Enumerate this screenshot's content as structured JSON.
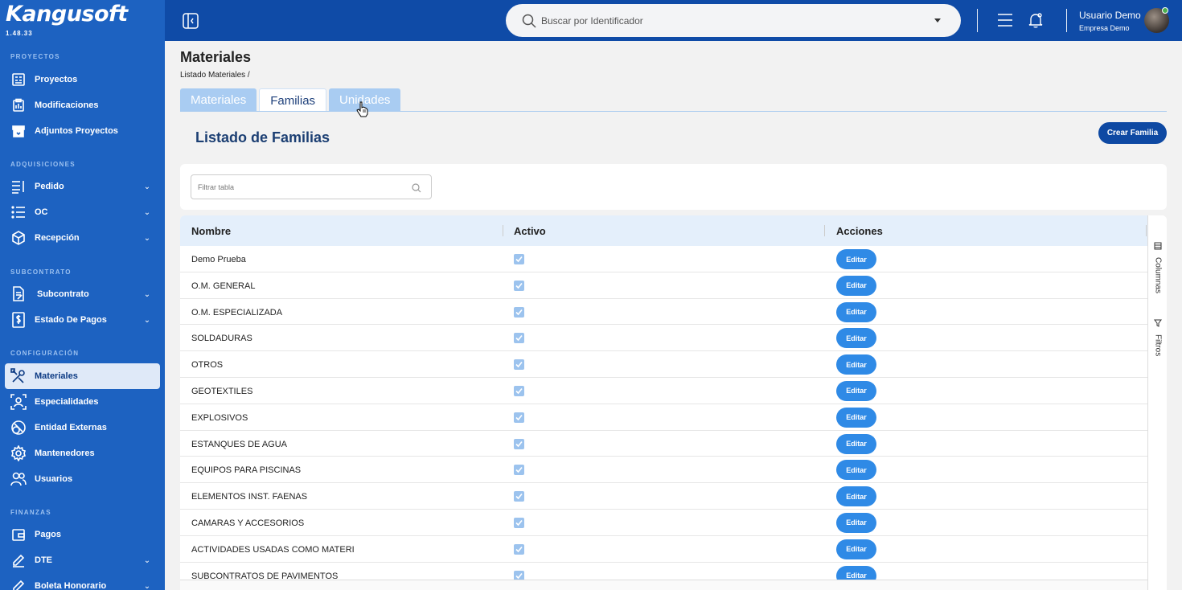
{
  "app": {
    "logo": "Kangusoft",
    "version": "1.48.33"
  },
  "sidebar": {
    "sections": [
      {
        "title": "PROYECTOS"
      },
      {
        "title": "ADQUISICIONES"
      },
      {
        "title": "SUBCONTRATO"
      },
      {
        "title": "CONFIGURACIÓN"
      },
      {
        "title": "FINANZAS"
      }
    ],
    "items": [
      {
        "label": "Proyectos",
        "icon": "projects-icon"
      },
      {
        "label": "Modificaciones",
        "icon": "modifications-icon"
      },
      {
        "label": "Adjuntos Proyectos",
        "icon": "archive-icon"
      },
      {
        "label": "Pedido",
        "icon": "list-icon"
      },
      {
        "label": "OC",
        "icon": "list-bullets-icon"
      },
      {
        "label": "Recepción",
        "icon": "box-icon"
      },
      {
        "label": "Subcontrato",
        "icon": "document-edit-icon"
      },
      {
        "label": "Estado De Pagos",
        "icon": "dollar-icon"
      },
      {
        "label": "Materiales",
        "icon": "tools-icon"
      },
      {
        "label": "Especialidades",
        "icon": "user-frame-icon"
      },
      {
        "label": "Entidad Externas",
        "icon": "circles-icon"
      },
      {
        "label": "Mantenedores",
        "icon": "gear-icon"
      },
      {
        "label": "Usuarios",
        "icon": "users-icon"
      },
      {
        "label": "Pagos",
        "icon": "wallet-icon"
      },
      {
        "label": "DTE",
        "icon": "pencil-icon"
      },
      {
        "label": "Boleta Honorario",
        "icon": "pencil-icon"
      }
    ]
  },
  "topbar": {
    "search_placeholder": "Buscar por Identificador",
    "user_name": "Usuario Demo",
    "company": "Empresa Demo"
  },
  "main": {
    "title": "Materiales",
    "breadcrumb": "Listado Materiales /",
    "tabs": [
      {
        "label": "Materiales"
      },
      {
        "label": "Familias"
      },
      {
        "label": "Unidades"
      }
    ],
    "section_heading": "Listado de Familias",
    "create_button": "Crear Familia",
    "filter_placeholder": "Filtrar tabla",
    "columns": [
      "Nombre",
      "Activo",
      "Acciones"
    ],
    "side_panel": {
      "columns": "Columnas",
      "filters": "Filtros"
    },
    "edit_label": "Editar",
    "rows": [
      {
        "name": "Demo Prueba",
        "active": true
      },
      {
        "name": "O.M. GENERAL",
        "active": true
      },
      {
        "name": "O.M. ESPECIALIZADA",
        "active": true
      },
      {
        "name": "SOLDADURAS",
        "active": true
      },
      {
        "name": "OTROS",
        "active": true
      },
      {
        "name": "GEOTEXTILES",
        "active": true
      },
      {
        "name": "EXPLOSIVOS",
        "active": true
      },
      {
        "name": "ESTANQUES DE AGUA",
        "active": true
      },
      {
        "name": "EQUIPOS PARA PISCINAS",
        "active": true
      },
      {
        "name": "ELEMENTOS INST. FAENAS",
        "active": true
      },
      {
        "name": "CAMARAS Y ACCESORIOS",
        "active": true
      },
      {
        "name": "ACTIVIDADES USADAS COMO MATERI",
        "active": true
      },
      {
        "name": "SUBCONTRATOS DE PAVIMENTOS",
        "active": true
      }
    ]
  },
  "colors": {
    "sidebar": "#1d62c1",
    "topbar": "#0f4ba7",
    "primary_button": "#0e49a3",
    "edit_button": "#2f8ae6"
  }
}
